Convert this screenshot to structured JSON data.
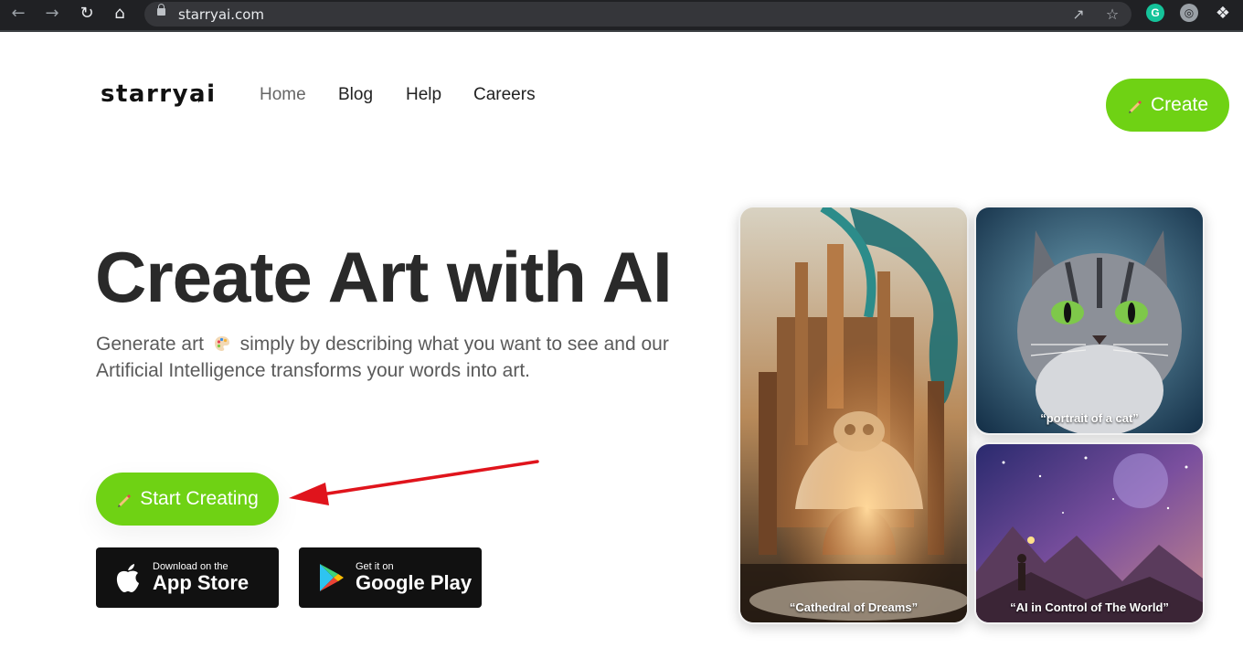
{
  "browser": {
    "url": "starryai.com",
    "icons": [
      "back-icon",
      "forward-icon",
      "reload-icon",
      "home-icon",
      "lock-icon",
      "share-icon",
      "bookmark-star-icon",
      "grammarly-extension-icon",
      "globe-extension-icon",
      "extensions-puzzle-icon"
    ],
    "grammarly_letter": "G"
  },
  "site": {
    "logo": "starryai",
    "logo_star": "✦",
    "nav": [
      "Home",
      "Blog",
      "Help",
      "Careers"
    ],
    "create_label": "Create"
  },
  "hero": {
    "title": "Create Art with AI",
    "subtitle_part1": "Generate art",
    "subtitle_part2": "simply by describing what you want to see and our Artificial Intelligence transforms your words into art.",
    "cta_label": "Start Creating"
  },
  "stores": {
    "app_store": {
      "small": "Download on the",
      "big": "App Store"
    },
    "google_play": {
      "small": "Get it on",
      "big": "Google Play"
    }
  },
  "gallery": [
    {
      "caption": "“Cathedral of Dreams”"
    },
    {
      "caption": "“portrait of a cat”"
    },
    {
      "caption": "“AI in Control of The World”"
    }
  ],
  "colors": {
    "accent_green": "#6fd214",
    "annotation_arrow": "#e0141c",
    "chrome_bg": "#202124"
  }
}
